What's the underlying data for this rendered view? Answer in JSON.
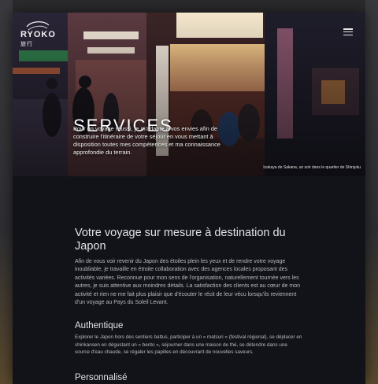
{
  "brand": {
    "name": "RYOKO",
    "tagline": "旅行"
  },
  "hero": {
    "title": "SERVICES",
    "text": "Pour un voyage réussi, je m'adapte à vos envies afin de construire l'itinéraire de votre séjour en vous mettant à disposition toutes mes compétences et ma connaissance approfondie du terrain.",
    "caption": "Izakaya de Sakana, un soir dans le quartier de Shinjuku",
    "signs": [
      "横丁 大勝屋 そば うどん",
      "思い出横丁"
    ]
  },
  "menu": {
    "icon": "hamburger-menu-icon"
  },
  "main": {
    "title": "Votre voyage sur mesure à destination du Japon",
    "text": "Afin de vous voir revenir du Japon des étoiles plein les yeux et de rendre votre voyage inoubliable, je travaille en étroite collaboration avec des agences locales proposant des activités variées. Reconnue pour mon sens de l'organisation, naturellement tournée vers les autres, je suis attentive aux moindres détails. La satisfaction des clients est au cœur de mon activité et rien ne me fait plus plaisir que d'écouter le récit de leur vécu lorsqu'ils reviennent d'un voyage au Pays du Soleil Levant."
  },
  "sections": [
    {
      "title": "Authentique",
      "text": "Explorer le Japon hors des sentiers battus, participer à un « matsuri » (festival régional), se déplacer en shinkansen en dégustant un « bento », séjourner dans une maison de thé, se détendre dans une source d'eau chaude, se régaler les papilles en découvrant de nouvelles saveurs."
    },
    {
      "title": "Personnalisé"
    }
  ],
  "colors": {
    "page_bg": "#121219",
    "accent_red": "#d9302a",
    "text_light": "#e2e2e6"
  }
}
